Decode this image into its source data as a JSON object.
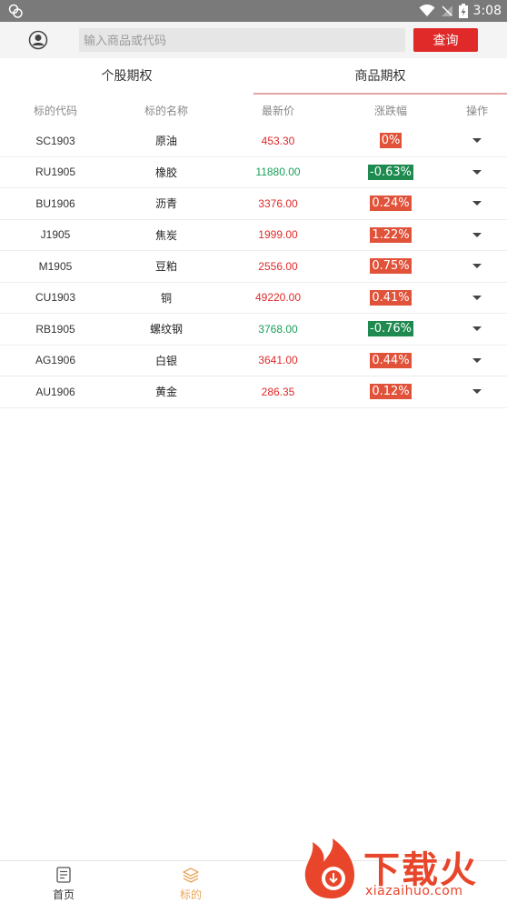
{
  "status_bar": {
    "time": "3:08"
  },
  "search": {
    "placeholder": "输入商品或代码",
    "value": "",
    "button_label": "查询"
  },
  "tabs": [
    {
      "label": "个股期权",
      "active": false
    },
    {
      "label": "商品期权",
      "active": true
    }
  ],
  "table": {
    "columns": [
      "标的代码",
      "标的名称",
      "最新价",
      "涨跌幅",
      "操作"
    ],
    "rows": [
      {
        "code": "SC1903",
        "name": "原油",
        "price": "453.30",
        "change": "0%",
        "direction": "up"
      },
      {
        "code": "RU1905",
        "name": "橡胶",
        "price": "11880.00",
        "change": "-0.63%",
        "direction": "down"
      },
      {
        "code": "BU1906",
        "name": "沥青",
        "price": "3376.00",
        "change": "0.24%",
        "direction": "up"
      },
      {
        "code": "J1905",
        "name": "焦炭",
        "price": "1999.00",
        "change": "1.22%",
        "direction": "up"
      },
      {
        "code": "M1905",
        "name": "豆粕",
        "price": "2556.00",
        "change": "0.75%",
        "direction": "up"
      },
      {
        "code": "CU1903",
        "name": "铜",
        "price": "49220.00",
        "change": "0.41%",
        "direction": "up"
      },
      {
        "code": "RB1905",
        "name": "螺纹钢",
        "price": "3768.00",
        "change": "-0.76%",
        "direction": "down"
      },
      {
        "code": "AG1906",
        "name": "白银",
        "price": "3641.00",
        "change": "0.44%",
        "direction": "up"
      },
      {
        "code": "AU1906",
        "name": "黄金",
        "price": "286.35",
        "change": "0.12%",
        "direction": "up"
      }
    ]
  },
  "colors": {
    "up_text": "#e02a2a",
    "down_text": "#1aa05a",
    "up_badge": "#e0523a",
    "down_badge": "#1e8a4f",
    "accent": "#e02a2a",
    "nav_active": "#e9a65a"
  },
  "bottom_nav": [
    {
      "label": "首页",
      "icon": "document-icon",
      "active": false
    },
    {
      "label": "标的",
      "icon": "layers-icon",
      "active": true
    }
  ],
  "watermark": {
    "cn": "下载火",
    "en": "xiazaihuo.com"
  }
}
